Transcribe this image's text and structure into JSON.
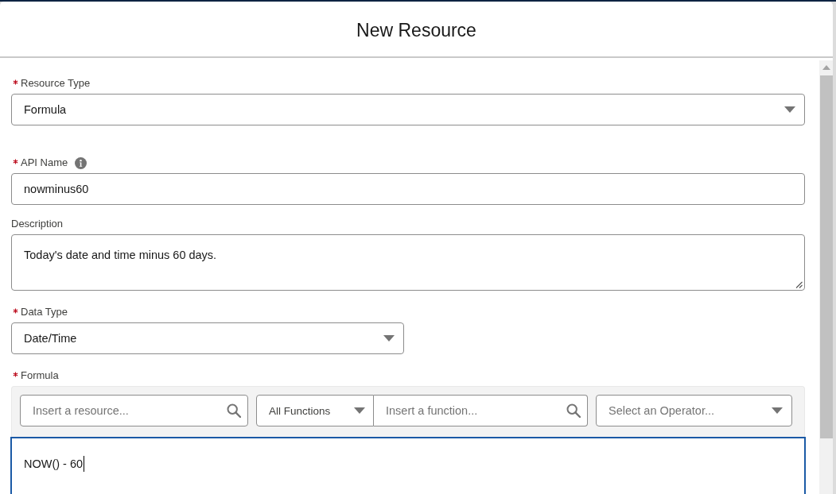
{
  "modal": {
    "title": "New Resource"
  },
  "resource_type": {
    "label": "Resource Type",
    "required": true,
    "value": "Formula"
  },
  "api_name": {
    "label": "API Name",
    "required": true,
    "value": "nowminus60"
  },
  "description": {
    "label": "Description",
    "required": false,
    "value": "Today's date and time minus 60 days."
  },
  "data_type": {
    "label": "Data Type",
    "required": true,
    "value": "Date/Time"
  },
  "formula": {
    "label": "Formula",
    "required": true,
    "resource_search": {
      "placeholder": "Insert a resource..."
    },
    "function_category": {
      "value": "All Functions"
    },
    "function_search": {
      "placeholder": "Insert a function..."
    },
    "operator": {
      "placeholder": "Select an Operator..."
    },
    "value": "NOW() - 60",
    "focused": true
  }
}
